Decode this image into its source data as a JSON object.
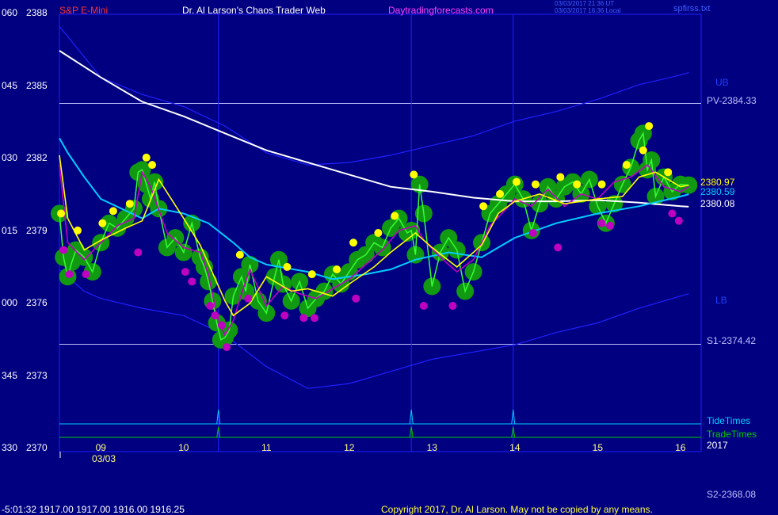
{
  "header": {
    "left_label": "S&P E-Mini",
    "center_title": "Dr. Al Larson's Chaos Trader Web",
    "site": "Daytradingforecasts.com",
    "timestamp_utc": "03/03/2017 21:36 UT",
    "timestamp_local": "03/03/2017 16:36 Local",
    "file": "spfirss.txt"
  },
  "colors": {
    "background": "#000080",
    "plot_border": "#0000ff",
    "green": "#00cc00",
    "yellow": "#ffff00",
    "magenta": "#c000c0",
    "cyan": "#00ccff",
    "white": "#ffffff",
    "band": "#2020ff",
    "red_label": "#ff3030"
  },
  "footer": {
    "ohlc": "-5:01:32  1917.00 1917.00 1916.00 1916.25",
    "copyright": "Copyright 2017, Dr. Al Larson. May not be copied by any means.",
    "s2_label": "S2-2368.08"
  },
  "chart_data": {
    "type": "line",
    "y_ticks": [
      {
        "angle": "060",
        "price": "2388"
      },
      {
        "angle": "045",
        "price": "2385"
      },
      {
        "angle": "030",
        "price": "2382"
      },
      {
        "angle": "015",
        "price": "2379"
      },
      {
        "angle": "000",
        "price": "2376"
      },
      {
        "angle": "345",
        "price": "2373"
      },
      {
        "angle": "330",
        "price": "2370"
      }
    ],
    "ylim": [
      2370,
      2388
    ],
    "x_ticks": [
      "09",
      "10",
      "11",
      "12",
      "13",
      "14",
      "15",
      "16"
    ],
    "xlim": [
      8.5,
      16.25
    ],
    "x_date_label": "03/03",
    "year_label": "2017",
    "levels": [
      {
        "label": "PV-2384.33",
        "value": 2384.33
      },
      {
        "label": "S1-2374.42",
        "value": 2374.42
      }
    ],
    "band_labels": {
      "upper": "UB",
      "lower": "LB"
    },
    "last_values": {
      "high": "2380.97",
      "mid": "2380.59",
      "low": "2380.08"
    },
    "timing_lines": {
      "tide_label": "TideTimes",
      "trade_label": "TradeTimes",
      "times": [
        10.42,
        12.75,
        13.98
      ]
    },
    "series": [
      {
        "key": "white",
        "color": "#ffffff",
        "x": [
          8.5,
          9.0,
          9.5,
          10.0,
          10.5,
          11.0,
          11.5,
          12.0,
          12.5,
          13.0,
          13.5,
          14.0,
          14.5,
          15.0,
          15.5,
          16.0,
          16.1
        ],
        "y": [
          2386.5,
          2385.4,
          2384.4,
          2383.8,
          2383.1,
          2382.4,
          2381.9,
          2381.4,
          2380.9,
          2380.7,
          2380.45,
          2380.3,
          2380.3,
          2380.35,
          2380.25,
          2380.1,
          2380.08
        ]
      },
      {
        "key": "cyan",
        "color": "#00ccff",
        "x": [
          8.5,
          8.6,
          8.8,
          9.0,
          9.5,
          9.7,
          10.0,
          10.3,
          10.6,
          10.8,
          11.0,
          11.5,
          11.8,
          12.2,
          12.5,
          12.8,
          13.2,
          13.6,
          14.0,
          14.5,
          15.0,
          15.5,
          16.0,
          16.1
        ],
        "y": [
          2382.9,
          2382.3,
          2381.3,
          2380.4,
          2379.6,
          2380.0,
          2379.8,
          2379.4,
          2378.6,
          2378.0,
          2377.7,
          2377.4,
          2377.1,
          2377.3,
          2377.5,
          2377.9,
          2378.2,
          2378.0,
          2378.8,
          2379.4,
          2379.8,
          2380.1,
          2380.5,
          2380.59
        ]
      },
      {
        "key": "upper_band",
        "color": "#2020ff",
        "x": [
          8.5,
          9.0,
          9.5,
          10.0,
          10.5,
          11.0,
          11.5,
          12.0,
          12.5,
          13.0,
          13.5,
          14.0,
          14.5,
          15.0,
          15.5,
          16.0,
          16.1
        ],
        "y": [
          2387.5,
          2385.4,
          2384.7,
          2384.2,
          2383.4,
          2382.3,
          2381.8,
          2381.9,
          2382.2,
          2382.6,
          2383.0,
          2383.6,
          2384.0,
          2384.5,
          2385.1,
          2385.5,
          2385.6
        ]
      },
      {
        "key": "lower_band",
        "color": "#2020ff",
        "x": [
          8.5,
          8.8,
          9.0,
          9.5,
          10.0,
          10.5,
          11.0,
          11.5,
          12.0,
          12.5,
          13.0,
          13.5,
          14.0,
          14.5,
          15.0,
          15.5,
          16.0,
          16.1
        ],
        "y": [
          2377.5,
          2376.6,
          2376.3,
          2375.9,
          2375.6,
          2374.8,
          2373.5,
          2372.6,
          2372.8,
          2373.3,
          2373.8,
          2374.1,
          2374.4,
          2374.9,
          2375.3,
          2375.9,
          2376.4,
          2376.5
        ]
      },
      {
        "key": "yellow",
        "color": "#ffff00",
        "x": [
          8.5,
          8.6,
          8.8,
          9.0,
          9.3,
          9.5,
          9.7,
          10.0,
          10.2,
          10.5,
          10.6,
          10.8,
          11.0,
          11.3,
          11.5,
          11.8,
          12.0,
          12.3,
          12.5,
          12.8,
          13.0,
          13.3,
          13.6,
          13.8,
          14.0,
          14.3,
          14.6,
          15.0,
          15.3,
          15.5,
          15.7,
          16.0,
          16.1
        ],
        "y": [
          2382.2,
          2379.6,
          2378.3,
          2378.7,
          2379.2,
          2379.5,
          2381.2,
          2379.6,
          2378.5,
          2376.2,
          2375.6,
          2376.1,
          2377.2,
          2376.6,
          2376.7,
          2376.4,
          2376.9,
          2377.6,
          2378.2,
          2379.0,
          2378.4,
          2377.6,
          2378.5,
          2379.8,
          2380.3,
          2380.6,
          2380.2,
          2380.4,
          2380.5,
          2381.3,
          2381.5,
          2380.9,
          2380.97
        ]
      },
      {
        "key": "magenta",
        "color": "#c000c0",
        "x": [
          8.5,
          8.6,
          8.8,
          9.0,
          9.2,
          9.4,
          9.5,
          9.6,
          9.8,
          10.0,
          10.2,
          10.3,
          10.4,
          10.5,
          10.6,
          10.7,
          10.8,
          11.0,
          11.2,
          11.4,
          11.6,
          11.8,
          12.0,
          12.2,
          12.4,
          12.6,
          12.8,
          12.9,
          13.1,
          13.3,
          13.5,
          13.7,
          13.9,
          14.0,
          14.2,
          14.4,
          14.6,
          14.8,
          15.0,
          15.2,
          15.4,
          15.6,
          15.8,
          16.0,
          16.1
        ],
        "y": [
          2381.8,
          2378.6,
          2377.9,
          2378.6,
          2379.3,
          2379.6,
          2381.5,
          2380.9,
          2379.0,
          2378.4,
          2378.2,
          2377.3,
          2375.6,
          2374.8,
          2375.4,
          2376.5,
          2377.5,
          2376.0,
          2376.8,
          2376.5,
          2376.3,
          2376.7,
          2377.1,
          2377.7,
          2378.3,
          2379.1,
          2379.3,
          2378.7,
          2378.0,
          2377.4,
          2377.9,
          2379.3,
          2380.0,
          2380.4,
          2380.1,
          2380.8,
          2380.1,
          2380.6,
          2380.4,
          2381.1,
          2381.3,
          2381.8,
          2380.9,
          2380.7,
          2380.9
        ]
      },
      {
        "key": "green_price",
        "color": "#00cc00",
        "x": [
          8.5,
          8.55,
          8.6,
          8.65,
          8.7,
          8.8,
          8.9,
          9.0,
          9.1,
          9.2,
          9.3,
          9.4,
          9.45,
          9.5,
          9.55,
          9.6,
          9.65,
          9.7,
          9.8,
          9.9,
          10.0,
          10.1,
          10.2,
          10.25,
          10.3,
          10.35,
          10.4,
          10.45,
          10.5,
          10.55,
          10.6,
          10.7,
          10.75,
          10.8,
          10.9,
          11.0,
          11.1,
          11.15,
          11.2,
          11.3,
          11.4,
          11.5,
          11.6,
          11.7,
          11.8,
          11.9,
          12.0,
          12.1,
          12.2,
          12.3,
          12.4,
          12.5,
          12.6,
          12.7,
          12.75,
          12.8,
          12.85,
          12.9,
          13.0,
          13.1,
          13.2,
          13.3,
          13.4,
          13.5,
          13.6,
          13.7,
          13.8,
          13.9,
          14.0,
          14.1,
          14.2,
          14.3,
          14.4,
          14.5,
          14.6,
          14.7,
          14.8,
          14.9,
          15.0,
          15.1,
          15.2,
          15.3,
          15.4,
          15.5,
          15.55,
          15.6,
          15.65,
          15.7,
          15.8,
          15.9,
          16.0,
          16.1
        ],
        "y": [
          2379.8,
          2378.0,
          2377.2,
          2377.8,
          2378.3,
          2378.0,
          2377.4,
          2378.6,
          2379.4,
          2379.2,
          2379.6,
          2380.0,
          2381.5,
          2381.6,
          2381.0,
          2380.4,
          2381.1,
          2380.0,
          2378.4,
          2378.8,
          2378.2,
          2379.4,
          2378.0,
          2377.6,
          2377.0,
          2376.2,
          2375.3,
          2374.6,
          2374.7,
          2375.0,
          2376.4,
          2377.2,
          2376.6,
          2377.7,
          2376.2,
          2375.7,
          2377.2,
          2377.9,
          2376.9,
          2376.2,
          2377.0,
          2375.9,
          2376.3,
          2376.6,
          2377.3,
          2376.9,
          2377.4,
          2377.9,
          2378.1,
          2378.6,
          2378.4,
          2379.2,
          2379.6,
          2379.0,
          2379.1,
          2378.1,
          2381.0,
          2379.8,
          2376.8,
          2378.2,
          2378.8,
          2378.3,
          2376.6,
          2377.4,
          2378.6,
          2379.8,
          2380.2,
          2380.6,
          2381.0,
          2380.4,
          2379.1,
          2380.2,
          2380.9,
          2380.4,
          2380.9,
          2381.1,
          2380.6,
          2381.2,
          2380.1,
          2379.4,
          2380.2,
          2381.0,
          2381.7,
          2382.8,
          2383.1,
          2381.6,
          2382.0,
          2380.5,
          2381.3,
          2380.7,
          2381.0,
          2380.97
        ]
      }
    ],
    "highs": {
      "x": [
        8.52,
        8.72,
        9.02,
        9.15,
        9.35,
        9.55,
        9.62,
        10.68,
        11.25,
        11.55,
        11.85,
        12.05,
        12.35,
        12.55,
        12.78,
        13.62,
        13.82,
        14.02,
        14.25,
        14.55,
        14.75,
        15.05,
        15.35,
        15.55,
        15.62,
        15.85
      ],
      "y": [
        2379.8,
        2379.1,
        2379.4,
        2379.9,
        2380.2,
        2382.1,
        2381.8,
        2378.1,
        2377.6,
        2377.3,
        2377.5,
        2378.6,
        2379.0,
        2379.7,
        2381.4,
        2380.1,
        2380.6,
        2381.1,
        2381.0,
        2381.3,
        2381.0,
        2381.0,
        2381.8,
        2382.4,
        2383.4,
        2381.5
      ]
    },
    "lows": {
      "x": [
        8.55,
        8.62,
        8.82,
        9.45,
        10.02,
        10.1,
        10.32,
        10.38,
        10.46,
        10.52,
        10.78,
        11.22,
        11.45,
        11.58,
        12.08,
        12.9,
        13.25,
        14.22,
        14.52,
        15.05,
        15.15,
        15.9,
        15.98
      ],
      "y": [
        2378.3,
        2377.3,
        2377.3,
        2378.2,
        2377.4,
        2377.0,
        2376.0,
        2375.6,
        2375.2,
        2374.3,
        2376.3,
        2375.6,
        2375.5,
        2375.5,
        2376.3,
        2376.0,
        2376.0,
        2379.0,
        2378.4,
        2379.4,
        2379.3,
        2379.8,
        2379.5
      ]
    }
  }
}
